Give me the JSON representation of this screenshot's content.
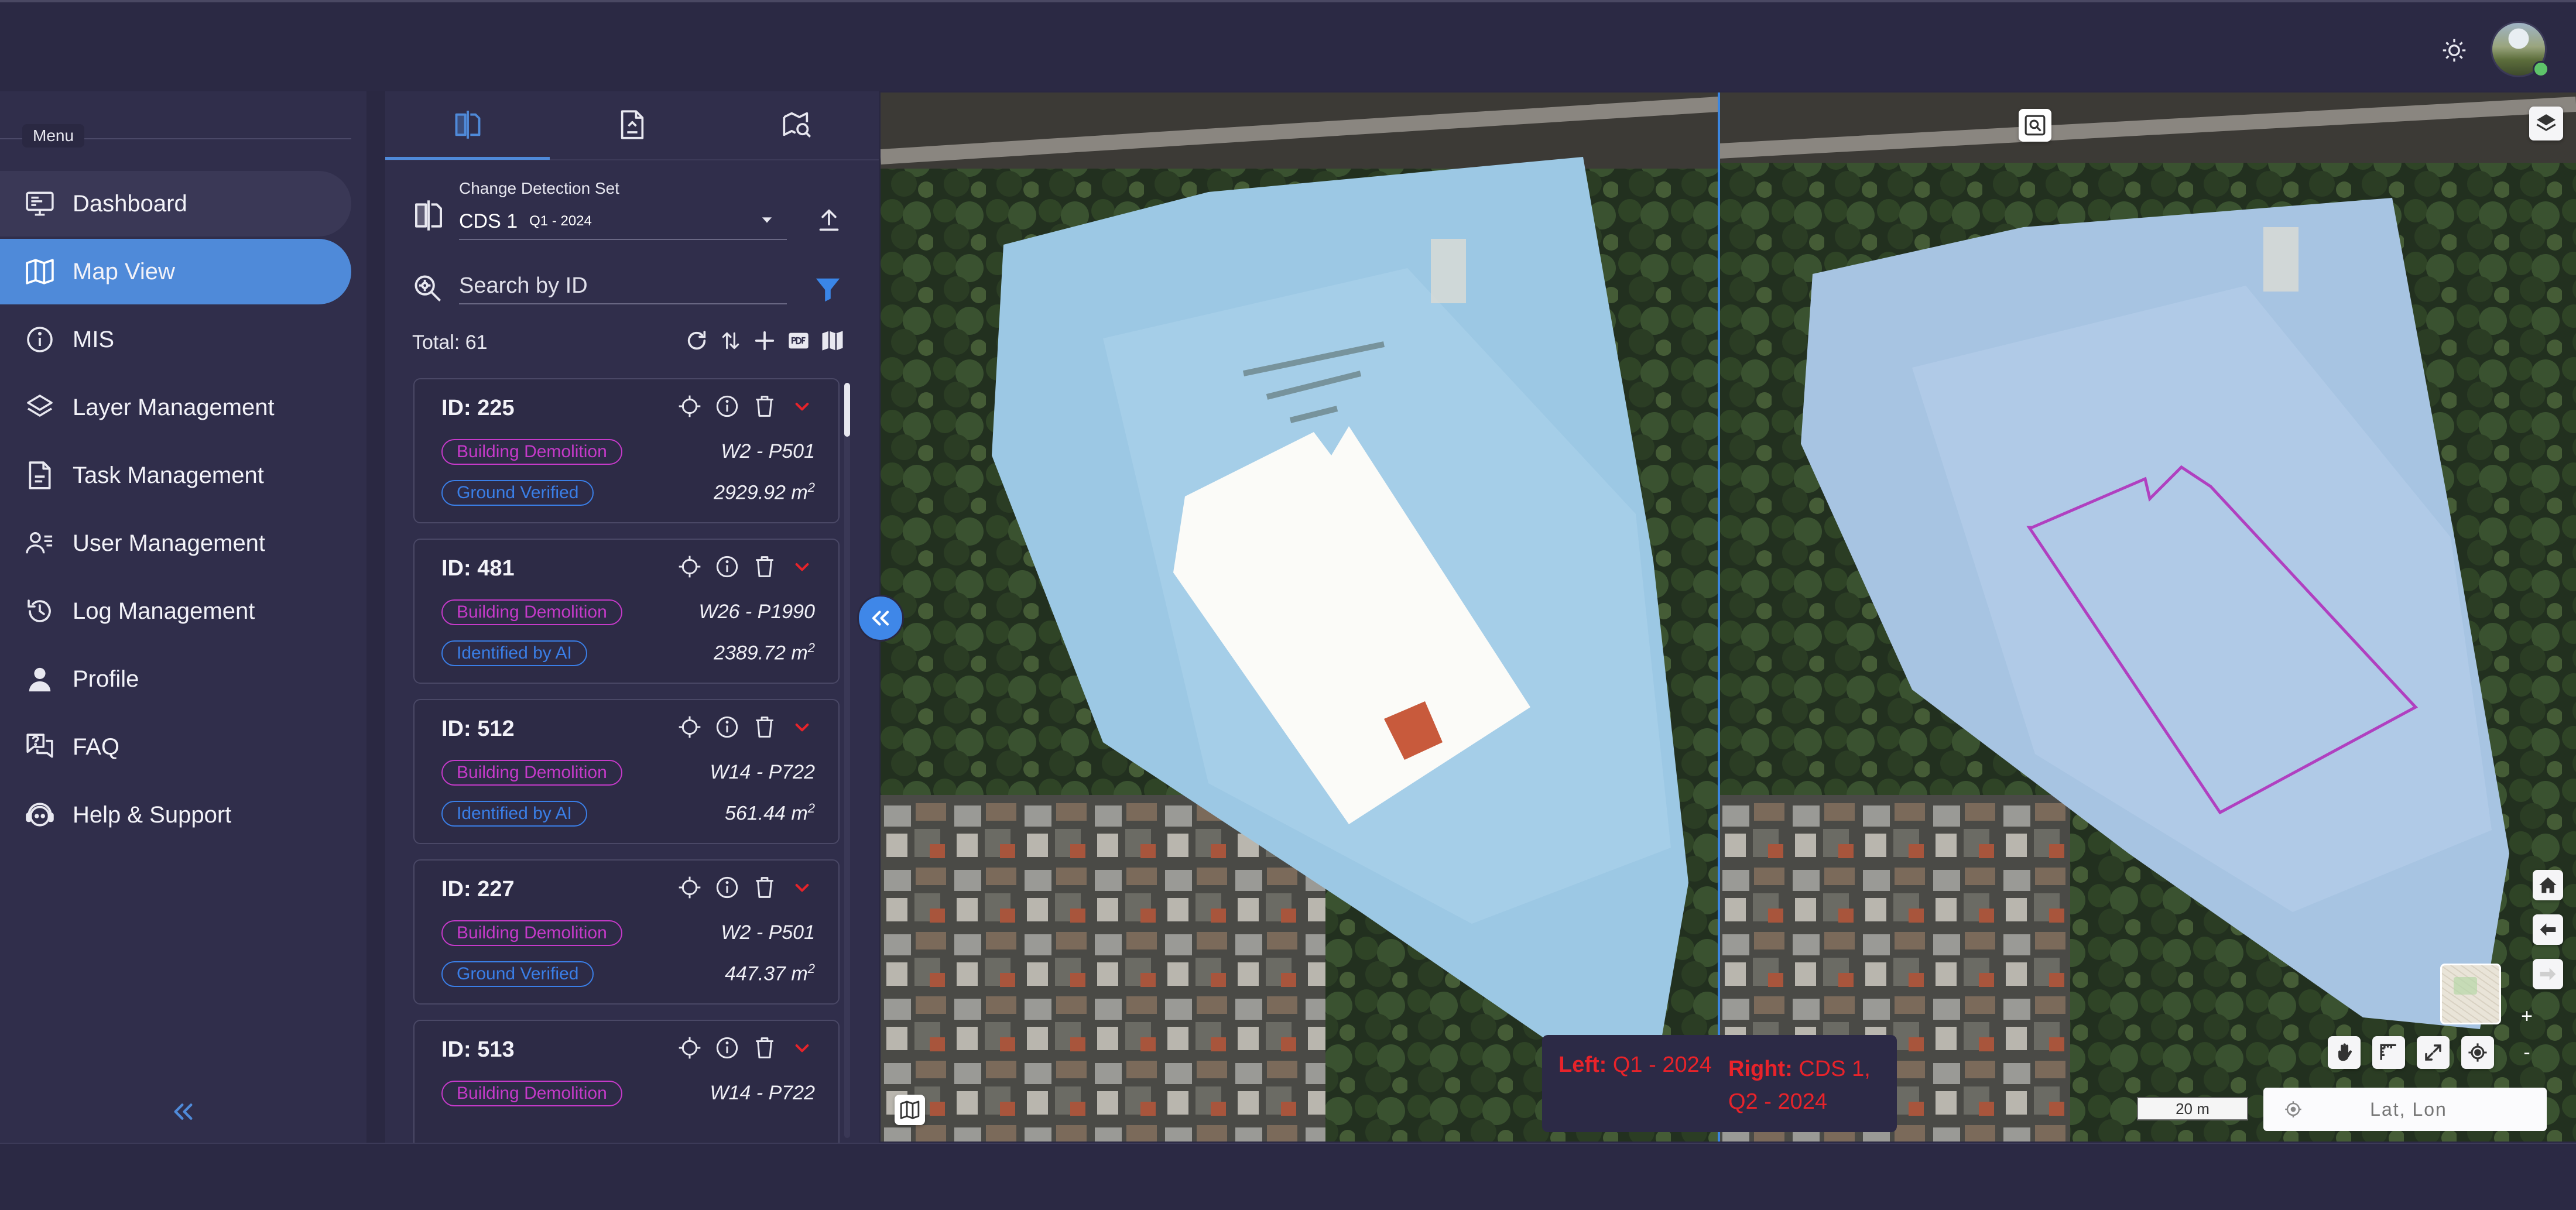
{
  "topbar": {
    "theme_icon": "sun-icon",
    "avatar_icon": "avatar-photo"
  },
  "sidebar": {
    "menu_label": "Menu",
    "items": [
      {
        "label": "Dashboard",
        "icon": "monitor-icon"
      },
      {
        "label": "Map View",
        "icon": "map-icon"
      },
      {
        "label": "MIS",
        "icon": "info-icon"
      },
      {
        "label": "Layer Management",
        "icon": "layers-icon"
      },
      {
        "label": "Task Management",
        "icon": "task-file-icon"
      },
      {
        "label": "User Management",
        "icon": "users-icon"
      },
      {
        "label": "Log Management",
        "icon": "history-icon"
      },
      {
        "label": "Profile",
        "icon": "person-icon"
      },
      {
        "label": "FAQ",
        "icon": "faq-icon"
      },
      {
        "label": "Help & Support",
        "icon": "support-icon"
      }
    ],
    "active_item": "Map View",
    "hover_item": "Dashboard",
    "collapse_icon": "double-chevron-left-icon"
  },
  "panel": {
    "tabs": [
      "compare-layers-icon",
      "report-file-icon",
      "map-search-icon"
    ],
    "active_tab": 0,
    "cds": {
      "label": "Change Detection Set",
      "value": "CDS 1",
      "sub_value": "Q1 - 2024"
    },
    "search": {
      "placeholder": "Search by ID"
    },
    "total_label": "Total: 61",
    "records": [
      {
        "id": "ID: 225",
        "type": "Building Demolition",
        "status": "Ground Verified",
        "ref": "W2 - P501",
        "area": "2929.92",
        "unit": "m",
        "exp": "2"
      },
      {
        "id": "ID: 481",
        "type": "Building Demolition",
        "status": "Identified by AI",
        "ref": "W26 - P1990",
        "area": "2389.72",
        "unit": "m",
        "exp": "2"
      },
      {
        "id": "ID: 512",
        "type": "Building Demolition",
        "status": "Identified by AI",
        "ref": "W14 - P722",
        "area": "561.44",
        "unit": "m",
        "exp": "2"
      },
      {
        "id": "ID: 227",
        "type": "Building Demolition",
        "status": "Ground Verified",
        "ref": "W2 - P501",
        "area": "447.37",
        "unit": "m",
        "exp": "2"
      },
      {
        "id": "ID: 513",
        "type": "Building Demolition",
        "status": "",
        "ref": "W14 - P722",
        "area": "",
        "unit": "",
        "exp": ""
      }
    ]
  },
  "map": {
    "legend": {
      "left_key": "Left:",
      "left_value": "Q1 - 2024",
      "right_key": "Right:",
      "right_value": "CDS 1, Q2 - 2024"
    },
    "scale_label": "20 m",
    "latlon_placeholder": "Lat, Lon",
    "zoom_in": "+",
    "zoom_out": "-"
  },
  "colors": {
    "accent": "#4f8ad9",
    "badge_type": "#c53ac9",
    "badge_status": "#3a7ee6",
    "legend_text": "#e8232a",
    "polygon": "#b040c0"
  }
}
